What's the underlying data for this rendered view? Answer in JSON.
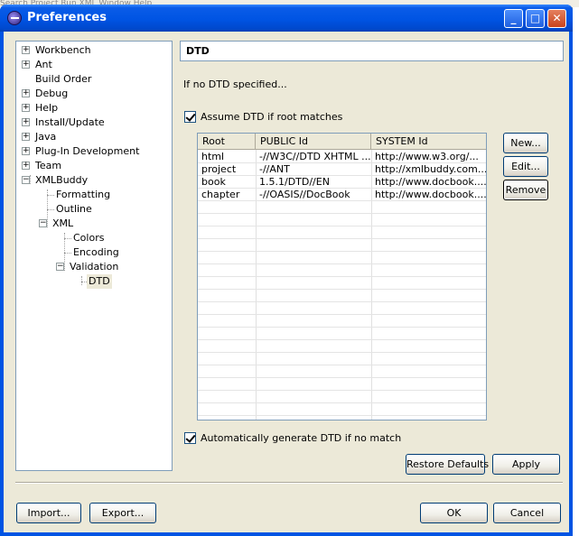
{
  "background": {
    "menubar_text": "Search  Project  Run  XML  Window  Help"
  },
  "window": {
    "title": "Preferences",
    "minimize": "_",
    "maximize": "□",
    "close": "✕"
  },
  "tree": {
    "items": [
      {
        "label": "Workbench",
        "expander": "+"
      },
      {
        "label": "Ant",
        "expander": "+"
      },
      {
        "label": "Build Order",
        "expander": ""
      },
      {
        "label": "Debug",
        "expander": "+"
      },
      {
        "label": "Help",
        "expander": "+"
      },
      {
        "label": "Install/Update",
        "expander": "+"
      },
      {
        "label": "Java",
        "expander": "+"
      },
      {
        "label": "Plug-In Development",
        "expander": "+"
      },
      {
        "label": "Team",
        "expander": "+"
      },
      {
        "label": "XMLBuddy",
        "expander": "−"
      },
      {
        "label": "Formatting",
        "expander": ""
      },
      {
        "label": "Outline",
        "expander": ""
      },
      {
        "label": "XML",
        "expander": "−"
      },
      {
        "label": "Colors",
        "expander": ""
      },
      {
        "label": "Encoding",
        "expander": ""
      },
      {
        "label": "Validation",
        "expander": "−"
      },
      {
        "label": "DTD",
        "expander": ""
      }
    ],
    "selected": "DTD"
  },
  "page": {
    "title": "DTD",
    "description": "If no DTD specified...",
    "assume_checkbox": {
      "label": "Assume DTD if root matches",
      "checked": true
    },
    "auto_checkbox": {
      "label": "Automatically generate DTD if no match",
      "checked": true
    }
  },
  "table": {
    "columns": [
      "Root",
      "PUBLIC Id",
      "SYSTEM Id"
    ],
    "rows": [
      [
        "html",
        "-//W3C//DTD XHTML ...",
        "http://www.w3.org/..."
      ],
      [
        "project",
        "-//ANT",
        "http://xmlbuddy.com..."
      ],
      [
        "book",
        "1.5.1/DTD//EN",
        "http://www.docbook...."
      ],
      [
        "chapter",
        "-//OASIS//DocBook",
        "http://www.docbook...."
      ]
    ]
  },
  "buttons": {
    "new": "New...",
    "edit": "Edit...",
    "remove": "Remove",
    "restore_defaults": "Restore Defaults",
    "apply": "Apply",
    "import": "Import...",
    "export": "Export...",
    "ok": "OK",
    "cancel": "Cancel"
  }
}
